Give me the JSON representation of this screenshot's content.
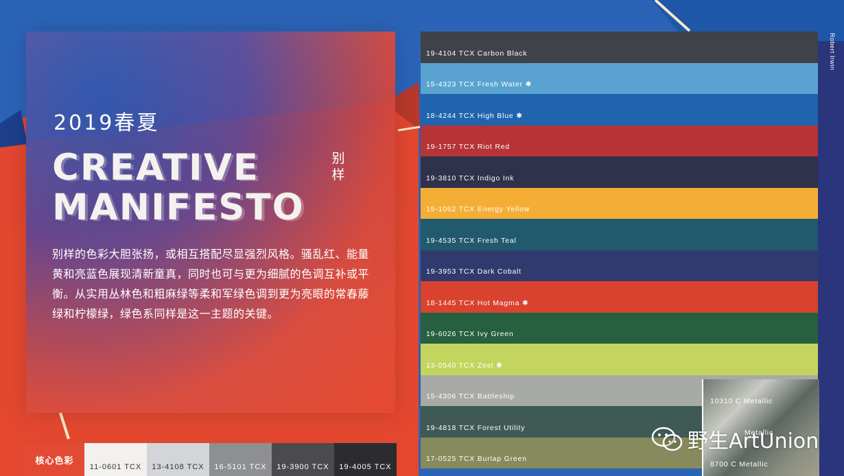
{
  "hero": {
    "season": "2019春夏",
    "headline_line1": "CREATIVE",
    "headline_line2": "MANIFESTO",
    "side_label_1": "别",
    "side_label_2": "样",
    "description": "别样的色彩大胆张扬，或相互搭配尽显强烈风格。骚乱红、能量黄和亮蓝色展现清新童真，同时也可与更为细腻的色调互补或平衡。从实用丛林色和粗麻绿等柔和军绿色调到更为亮眼的常春藤绿和柠檬绿，绿色系同样是这一主题的关键。"
  },
  "core_palette": {
    "label": "核心色彩",
    "chips": [
      {
        "code": "11-0601 TCX",
        "color": "#f2f1ee",
        "text_color": "#333333"
      },
      {
        "code": "13-4108 TCX",
        "color": "#d3d5d8",
        "text_color": "#333333"
      },
      {
        "code": "16-5101 TCX",
        "color": "#8e8f91",
        "text_color": "#ffffff"
      },
      {
        "code": "19-3900 TCX",
        "color": "#4b4a4e",
        "text_color": "#ffffff"
      },
      {
        "code": "19-4005 TCX",
        "color": "#2b2b30",
        "text_color": "#ffffff"
      }
    ]
  },
  "swatches": [
    {
      "label": "19-4104 TCX Carbon Black",
      "color": "#3f4249"
    },
    {
      "label": "15-4323 TCX Fresh Water ✱",
      "color": "#5aa3d0"
    },
    {
      "label": "18-4244 TCX High Blue ✱",
      "color": "#1f64ad"
    },
    {
      "label": "19-1757 TCX Riot Red",
      "color": "#b63336"
    },
    {
      "label": "19-3810 TCX Indigo Ink",
      "color": "#30314a"
    },
    {
      "label": "15-1062 TCX Energy Yellow",
      "color": "#f5ae35"
    },
    {
      "label": "19-4535 TCX Fresh Teal",
      "color": "#21596d"
    },
    {
      "label": "19-3953 TCX Dark Cobalt",
      "color": "#303a6f"
    },
    {
      "label": "18-1445 TCX Hot Magma ✱",
      "color": "#d8422f"
    },
    {
      "label": "19-6026 TCX Ivy Green",
      "color": "#27603f"
    },
    {
      "label": "13-0540 TCX Zest ✱",
      "color": "#c3d55e"
    },
    {
      "label": "15-4306 TCX Battleship",
      "color": "#a8aaa6"
    },
    {
      "label": "19-4818 TCX Forest Utility",
      "color": "#3f5a55"
    },
    {
      "label": "17-0525 TCX Burlap Green",
      "color": "#868a5c"
    }
  ],
  "metallic": {
    "top_label": "10310 C Metallic",
    "middle_label": "Metallic",
    "bottom_label": "8700 C Metallic"
  },
  "author": "Robert Irwin",
  "watermark": {
    "icon": "wechat-icon",
    "text": "野生ArtUnion"
  }
}
